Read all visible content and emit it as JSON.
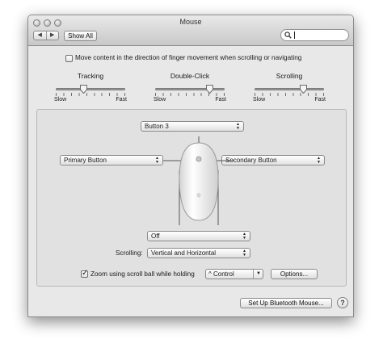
{
  "window": {
    "title": "Mouse"
  },
  "toolbar": {
    "back_label": "◀",
    "forward_label": "▶",
    "show_all_label": "Show All",
    "search_placeholder": ""
  },
  "options": {
    "scroll_direction_label": "Move content in the direction of finger movement when scrolling or navigating",
    "scroll_direction_checked": false
  },
  "sliders": [
    {
      "title": "Tracking",
      "min_label": "Slow",
      "max_label": "Fast",
      "value": 0.4
    },
    {
      "title": "Double-Click",
      "min_label": "Slow",
      "max_label": "Fast",
      "value": 0.78
    },
    {
      "title": "Scrolling",
      "min_label": "Slow",
      "max_label": "Fast",
      "value": 0.7
    }
  ],
  "buttons_config": {
    "top": "Button 3",
    "left": "Primary Button",
    "right": "Secondary Button",
    "bottom": "Off"
  },
  "scrolling": {
    "label": "Scrolling:",
    "value": "Vertical and Horizontal"
  },
  "zoom": {
    "label": "Zoom using scroll ball while holding",
    "checked": true,
    "modifier": "^ Control",
    "options_label": "Options..."
  },
  "footer": {
    "bluetooth_label": "Set Up Bluetooth Mouse...",
    "help_label": "?"
  }
}
